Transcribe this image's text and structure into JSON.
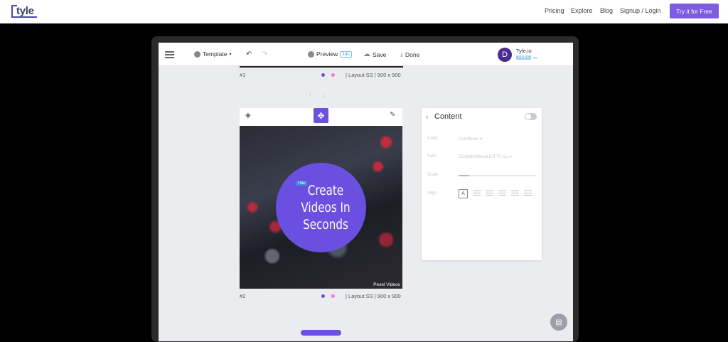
{
  "topnav": {
    "logo_text": "tyle",
    "links": [
      "Pricing",
      "Explore",
      "Blog",
      "Signup / Login"
    ],
    "cta": "Try it for Free"
  },
  "toolbar": {
    "template_label": "Template",
    "preview_label": "Preview",
    "preview_badge": "14s",
    "save_label": "Save",
    "done_label": "Done",
    "user_initial": "D",
    "user_name": "Tyle.io",
    "user_badge": "SUBS"
  },
  "scenes": [
    {
      "number": "#1",
      "layout": "Layout SS",
      "size": "900 x 900"
    },
    {
      "number": "#2",
      "layout": "Layout SS",
      "size": "900 x 900"
    }
  ],
  "scene_colors": [
    "#6c52d9",
    "#ffffff",
    "#f07ad6"
  ],
  "canvas": {
    "title_tag": "Title",
    "headline": [
      "Create",
      "Videos In",
      "Seconds"
    ],
    "credit": "Pexel Videos",
    "circle_color": "#6b4fe0"
  },
  "panel": {
    "title": "Content",
    "color_label": "Color",
    "color_value": "Cornflower",
    "font_label": "Font",
    "font_value": "SDGothicNeoaUniTTF-cLt",
    "scale_label": "Scale",
    "align_label": "Align",
    "align_box_text": "A"
  },
  "colors": {
    "brand": "#7d5ce0",
    "accent": "#6c52d9"
  }
}
